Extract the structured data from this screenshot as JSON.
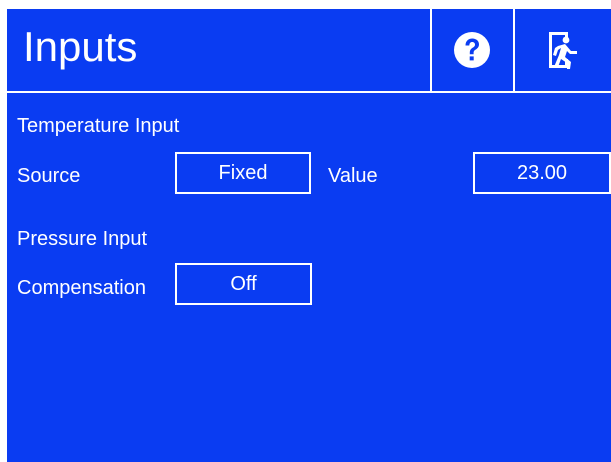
{
  "header": {
    "title": "Inputs",
    "help_icon": "help-icon",
    "exit_icon": "exit-icon"
  },
  "temperature": {
    "section_label": "Temperature Input",
    "source_label": "Source",
    "source_value": "Fixed",
    "value_label": "Value",
    "value": "23.00"
  },
  "pressure": {
    "section_label": "Pressure Input",
    "compensation_label": "Compensation",
    "compensation_value": "Off"
  },
  "colors": {
    "background": "#0a3cf2",
    "foreground": "#ffffff"
  }
}
